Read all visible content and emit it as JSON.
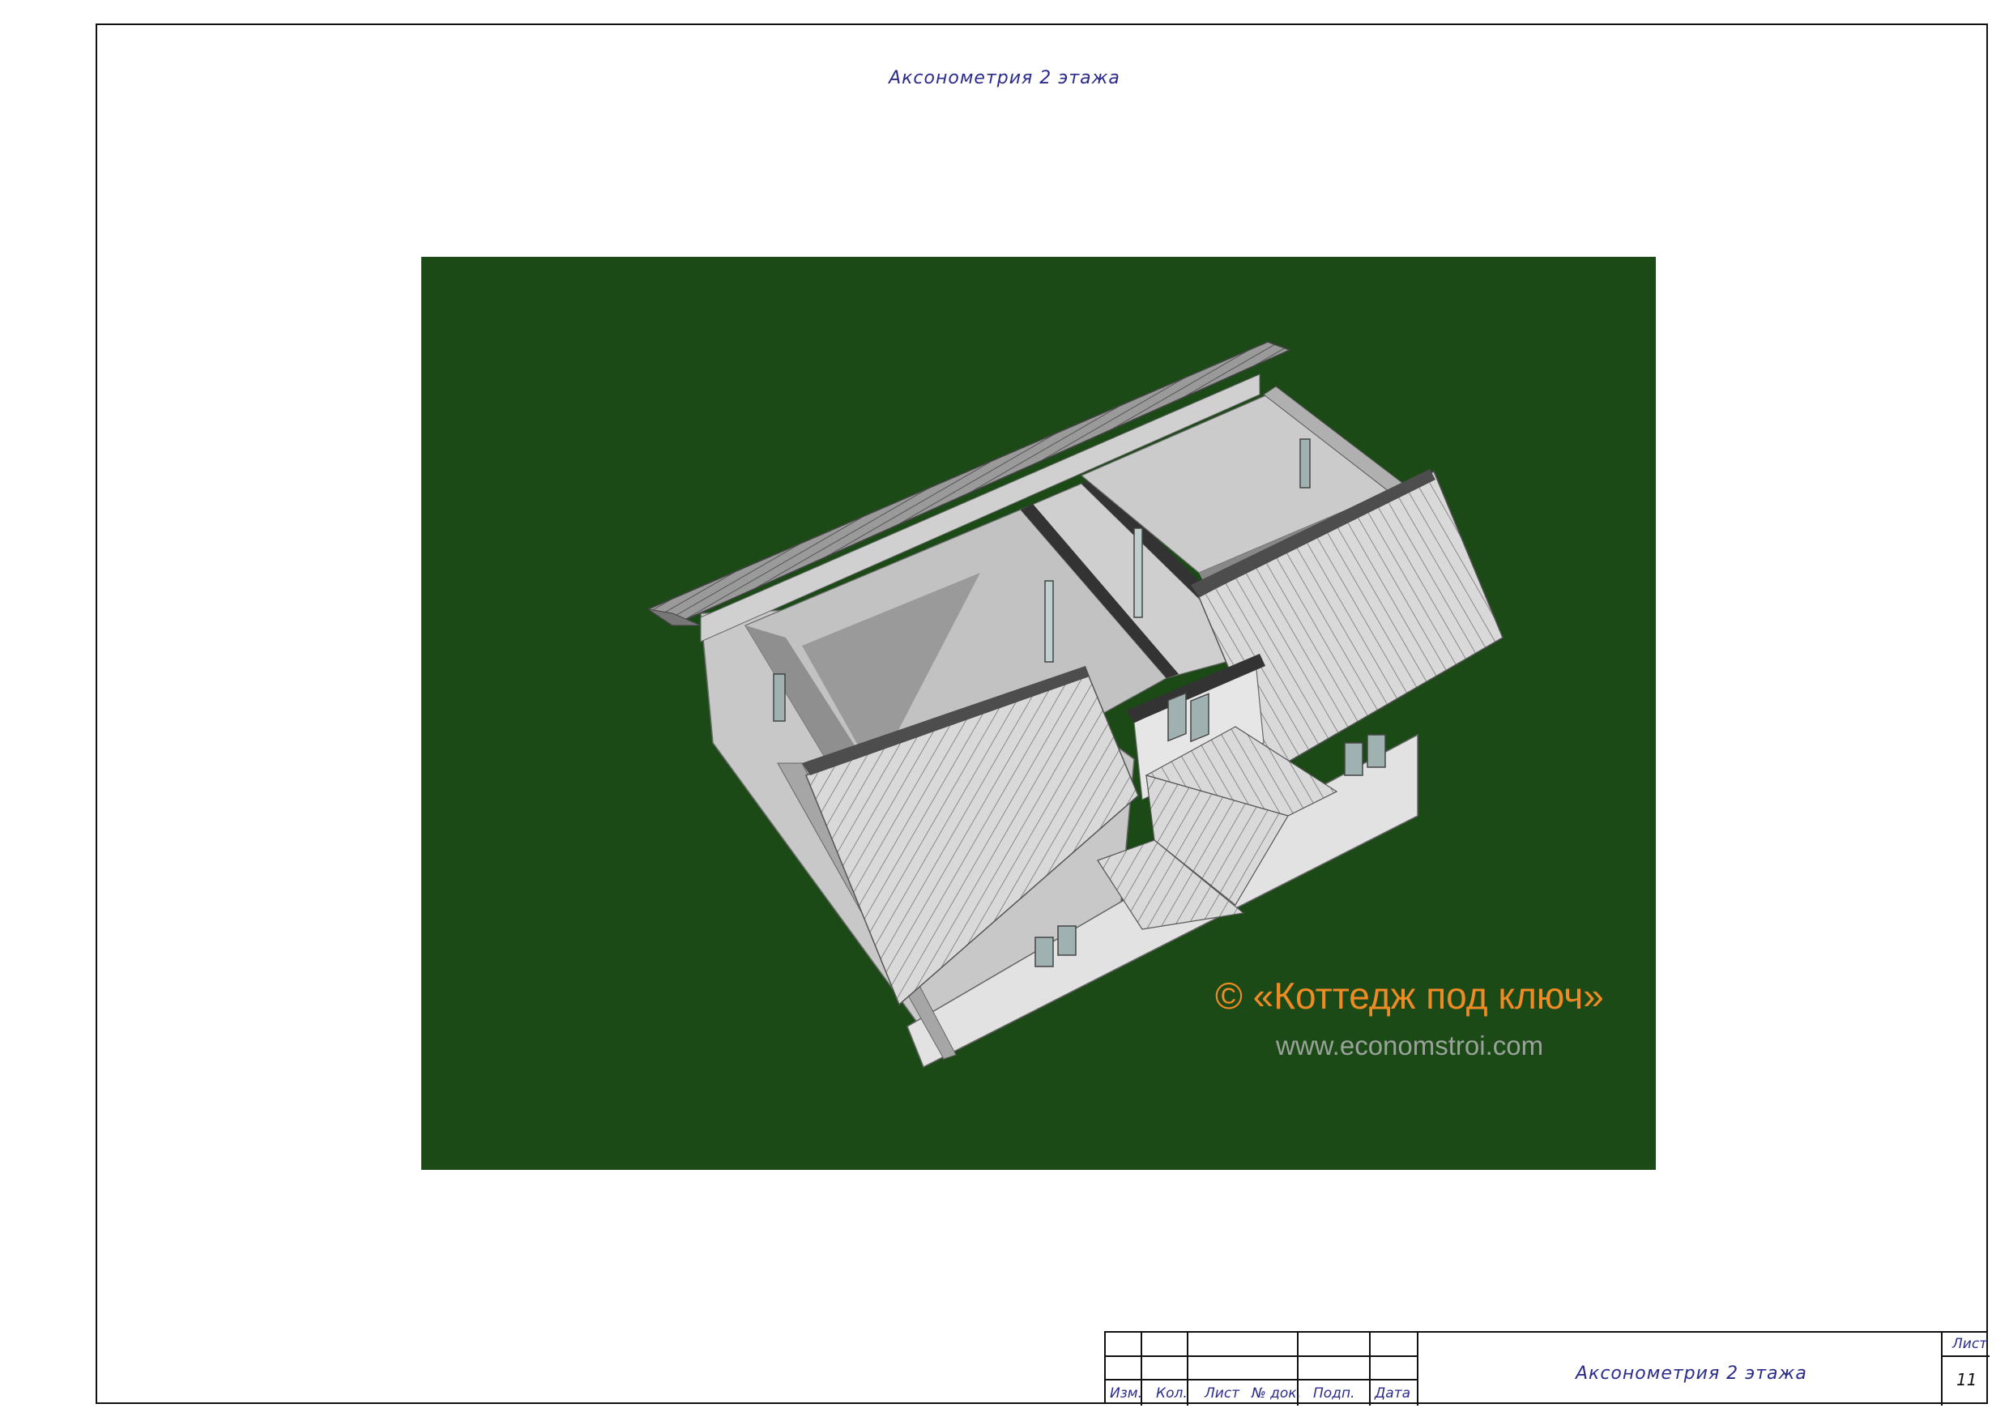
{
  "drawing": {
    "title": "Аксонометрия 2 этажа"
  },
  "watermark": {
    "brand": "© «Коттедж под ключ»",
    "url": "www.economstroi.com"
  },
  "title_block": {
    "columns": {
      "izm": "Изм.",
      "kol": "Кол.",
      "list": "Лист",
      "doc": "№ док.",
      "podp": "Подп.",
      "data": "Дата"
    },
    "title": "Аксонометрия 2 этажа",
    "sheet_label": "Лист",
    "sheet_number": "11"
  },
  "colors": {
    "background_panel": "#1b4a17",
    "watermark_brand": "#f08a24",
    "watermark_url": "#9aa39a",
    "drawing_text": "#2b2b8c"
  }
}
